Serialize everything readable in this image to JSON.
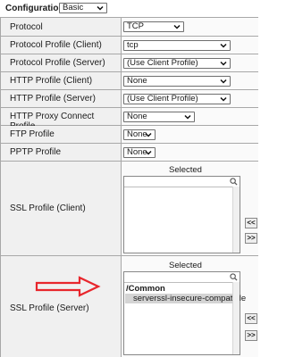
{
  "configuration": {
    "label": "Configuration:",
    "value": "Basic"
  },
  "rows": [
    {
      "label": "Protocol",
      "value": "TCP"
    },
    {
      "label": "Protocol Profile (Client)",
      "value": "tcp"
    },
    {
      "label": "Protocol Profile (Server)",
      "value": "(Use Client Profile)"
    },
    {
      "label": "HTTP Profile (Client)",
      "value": "None"
    },
    {
      "label": "HTTP Profile (Server)",
      "value": "(Use Client Profile)"
    },
    {
      "label": "HTTP Proxy Connect Profile",
      "value": "None"
    },
    {
      "label": "FTP Profile",
      "value": "None"
    },
    {
      "label": "PPTP Profile",
      "value": "None"
    }
  ],
  "ssl_client": {
    "label": "SSL Profile (Client)",
    "selected_title": "Selected",
    "move_left": "<<",
    "move_right": ">>"
  },
  "ssl_server": {
    "label": "SSL Profile (Server)",
    "selected_title": "Selected",
    "group": "/Common",
    "item": "serverssl-insecure-compatible",
    "move_left": "<<",
    "move_right": ">>"
  },
  "colors": {
    "annotation_arrow": "#e8262c",
    "selected_item_bg": "#d4d4d4"
  }
}
